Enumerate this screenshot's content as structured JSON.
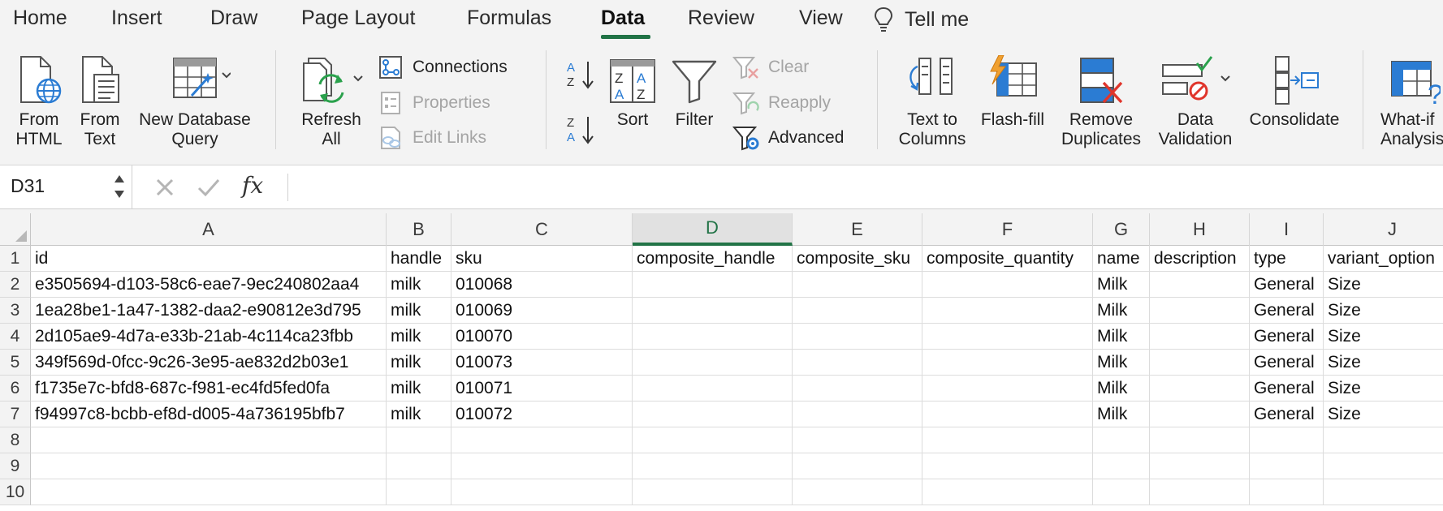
{
  "tabs": [
    {
      "label": "Home"
    },
    {
      "label": "Insert"
    },
    {
      "label": "Draw"
    },
    {
      "label": "Page Layout"
    },
    {
      "label": "Formulas"
    },
    {
      "label": "Data"
    },
    {
      "label": "Review"
    },
    {
      "label": "View"
    },
    {
      "label": "Tell me"
    }
  ],
  "active_tab": "Data",
  "accent_color": "#217346",
  "ribbon": {
    "from_html": "From HTML",
    "from_html_l1": "From",
    "from_html_l2": "HTML",
    "from_text_l1": "From",
    "from_text_l2": "Text",
    "new_query_l1": "New Database",
    "new_query_l2": "Query",
    "refresh_l1": "Refresh",
    "refresh_l2": "All",
    "connections": "Connections",
    "properties": "Properties",
    "edit_links": "Edit Links",
    "sort": "Sort",
    "filter": "Filter",
    "clear": "Clear",
    "reapply": "Reapply",
    "advanced": "Advanced",
    "text_to_columns_l1": "Text to",
    "text_to_columns_l2": "Columns",
    "flash_fill": "Flash-fill",
    "remove_dup_l1": "Remove",
    "remove_dup_l2": "Duplicates",
    "data_validation_l1": "Data",
    "data_validation_l2": "Validation",
    "consolidate": "Consolidate",
    "what_if_l1": "What-if",
    "what_if_l2": "Analysis",
    "icons": [
      "globe-document-icon",
      "text-document-icon",
      "database-query-icon",
      "refresh-icon",
      "connections-icon",
      "properties-icon",
      "edit-links-icon",
      "sort-az-icon",
      "sort-za-icon",
      "sort-icon",
      "filter-icon",
      "clear-filter-icon",
      "reapply-icon",
      "advanced-filter-icon",
      "text-to-columns-icon",
      "flash-fill-icon",
      "remove-duplicates-icon",
      "data-validation-icon",
      "consolidate-icon",
      "what-if-icon"
    ]
  },
  "formula_bar": {
    "name_box": "D31",
    "fx": "fx",
    "formula": ""
  },
  "sheet": {
    "columns": [
      "A",
      "B",
      "C",
      "D",
      "E",
      "F",
      "G",
      "H",
      "I",
      "J"
    ],
    "selected_column": "D",
    "rows": [
      {
        "num": "1",
        "cells": [
          "id",
          "handle",
          "sku",
          "composite_handle",
          "composite_sku",
          "composite_quantity",
          "name",
          "description",
          "type",
          "variant_option"
        ]
      },
      {
        "num": "2",
        "cells": [
          "e3505694-d103-58c6-eae7-9ec240802aa4",
          "milk",
          "010068",
          "",
          "",
          "",
          "Milk",
          "",
          "General",
          "Size"
        ]
      },
      {
        "num": "3",
        "cells": [
          "1ea28be1-1a47-1382-daa2-e90812e3d795",
          "milk",
          "010069",
          "",
          "",
          "",
          "Milk",
          "",
          "General",
          "Size"
        ]
      },
      {
        "num": "4",
        "cells": [
          "2d105ae9-4d7a-e33b-21ab-4c114ca23fbb",
          "milk",
          "010070",
          "",
          "",
          "",
          "Milk",
          "",
          "General",
          "Size"
        ]
      },
      {
        "num": "5",
        "cells": [
          "349f569d-0fcc-9c26-3e95-ae832d2b03e1",
          "milk",
          "010073",
          "",
          "",
          "",
          "Milk",
          "",
          "General",
          "Size"
        ]
      },
      {
        "num": "6",
        "cells": [
          "f1735e7c-bfd8-687c-f981-ec4fd5fed0fa",
          "milk",
          "010071",
          "",
          "",
          "",
          "Milk",
          "",
          "General",
          "Size"
        ]
      },
      {
        "num": "7",
        "cells": [
          "f94997c8-bcbb-ef8d-d005-4a736195bfb7",
          "milk",
          "010072",
          "",
          "",
          "",
          "Milk",
          "",
          "General",
          "Size"
        ]
      },
      {
        "num": "8",
        "cells": [
          "",
          "",
          "",
          "",
          "",
          "",
          "",
          "",
          "",
          ""
        ]
      },
      {
        "num": "9",
        "cells": [
          "",
          "",
          "",
          "",
          "",
          "",
          "",
          "",
          "",
          ""
        ]
      },
      {
        "num": "10",
        "cells": [
          "",
          "",
          "",
          "",
          "",
          "",
          "",
          "",
          "",
          ""
        ]
      }
    ]
  }
}
